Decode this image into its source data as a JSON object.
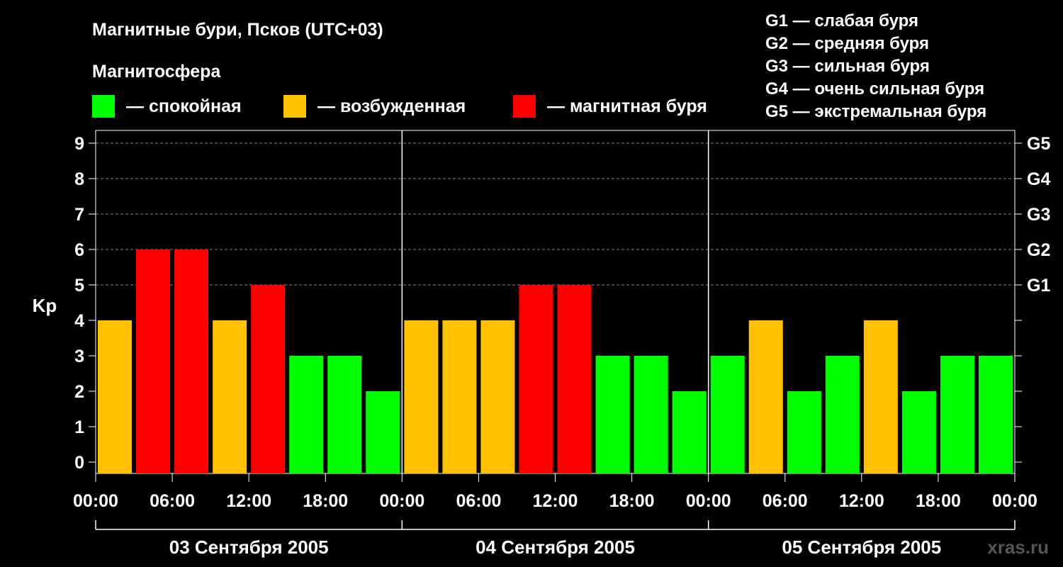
{
  "header": {
    "title": "Магнитные бури, Псков (UTC+03)",
    "legend_title": "Магнитосфера"
  },
  "legend": [
    {
      "label": "— спокойная",
      "color": "#00ff00"
    },
    {
      "label": "— возбужденная",
      "color": "#ffc000"
    },
    {
      "label": "— магнитная буря",
      "color": "#ff0000"
    }
  ],
  "storm_scale": [
    "G1 — слабая буря",
    "G2 — средняя буря",
    "G3 — сильная буря",
    "G4 — очень сильная буря",
    "G5 — экстремальная буря"
  ],
  "watermark": "xras.ru",
  "chart_data": {
    "type": "bar",
    "title": "Магнитные бури, Псков (UTC+03)",
    "ylabel": "Kp",
    "ylim": [
      0,
      9
    ],
    "y_ticks": [
      "0",
      "1",
      "2",
      "3",
      "4",
      "5",
      "6",
      "7",
      "8",
      "9"
    ],
    "right_ticks": [
      {
        "value": 5,
        "label": "G1"
      },
      {
        "value": 6,
        "label": "G2"
      },
      {
        "value": 7,
        "label": "G3"
      },
      {
        "value": 8,
        "label": "G4"
      },
      {
        "value": 9,
        "label": "G5"
      }
    ],
    "x_tick_labels": [
      "00:00",
      "06:00",
      "12:00",
      "18:00",
      "00:00",
      "06:00",
      "12:00",
      "18:00",
      "00:00",
      "06:00",
      "12:00",
      "18:00",
      "00:00"
    ],
    "days": [
      "03 Сентября 2005",
      "04 Сентября 2005",
      "05 Сентября 2005"
    ],
    "bar_hours": 3,
    "values": [
      4,
      6,
      6,
      4,
      5,
      3,
      3,
      2,
      4,
      4,
      4,
      5,
      5,
      3,
      3,
      2,
      3,
      4,
      2,
      3,
      4,
      2,
      3,
      3
    ],
    "levels": [
      "возбужденная",
      "магнитная буря",
      "магнитная буря",
      "возбужденная",
      "магнитная буря",
      "спокойная",
      "спокойная",
      "спокойная",
      "возбужденная",
      "возбужденная",
      "возбужденная",
      "магнитная буря",
      "магнитная буря",
      "спокойная",
      "спокойная",
      "спокойная",
      "спокойная",
      "возбужденная",
      "спокойная",
      "спокойная",
      "возбужденная",
      "спокойная",
      "спокойная",
      "спокойная"
    ],
    "colors": {
      "спокойная": "#00ff00",
      "возбужденная": "#ffc000",
      "магнитная буря": "#ff0000"
    },
    "grid": true
  }
}
